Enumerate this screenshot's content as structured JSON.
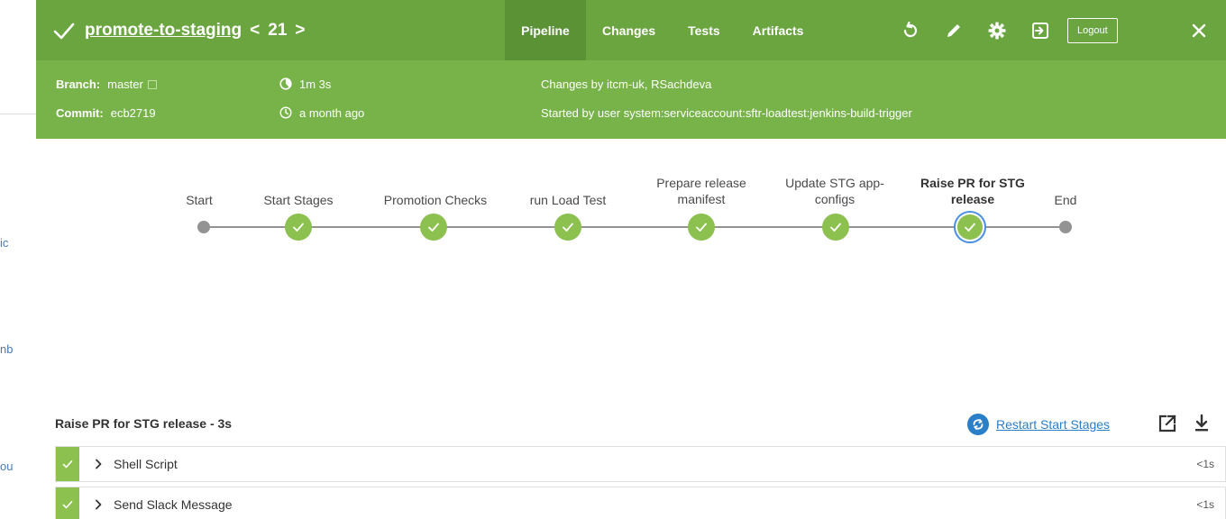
{
  "background_links": {
    "frag1": "ic",
    "frag2": "nb",
    "frag3": "ou"
  },
  "header": {
    "run_name": "promote-to-staging",
    "run_number": "21",
    "prev_arrow": "<",
    "next_arrow": ">",
    "tabs": [
      {
        "label": "Pipeline",
        "active": true
      },
      {
        "label": "Changes",
        "active": false
      },
      {
        "label": "Tests",
        "active": false
      },
      {
        "label": "Artifacts",
        "active": false
      }
    ],
    "logout_label": "Logout",
    "branch_label": "Branch:",
    "branch_value": "master",
    "commit_label": "Commit:",
    "commit_value": "ecb2719",
    "duration": "1m 3s",
    "started_ago": "a month ago",
    "changes_by": "Changes by itcm-uk, RSachdeva",
    "started_by": "Started by user system:serviceaccount:sftr-loadtest:jenkins-build-trigger",
    "colors": {
      "top": "#6aa53f",
      "body": "#77b348",
      "active_tab": "#5b9235"
    }
  },
  "pipeline": {
    "stages": [
      {
        "label": "Start",
        "status": "start"
      },
      {
        "label": "Start Stages",
        "status": "success"
      },
      {
        "label": "Promotion Checks",
        "status": "success"
      },
      {
        "label": "run Load Test",
        "status": "success"
      },
      {
        "label_line1": "Prepare release",
        "label_line2": "manifest",
        "status": "success"
      },
      {
        "label_line1": "Update STG app-",
        "label_line2": "configs",
        "status": "success"
      },
      {
        "label_line1": "Raise PR for STG",
        "label_line2": "release",
        "status": "selected"
      },
      {
        "label": "End",
        "status": "end"
      }
    ],
    "colors": {
      "success": "#8cc04f",
      "selected_ring": "#4a90e2",
      "track": "#949393"
    }
  },
  "steps": {
    "title": "Raise PR for STG release - 3s",
    "restart_label": "Restart Start Stages",
    "items": [
      {
        "name": "Shell Script",
        "duration": "<1s"
      },
      {
        "name": "Send Slack Message",
        "duration": "<1s"
      }
    ]
  }
}
